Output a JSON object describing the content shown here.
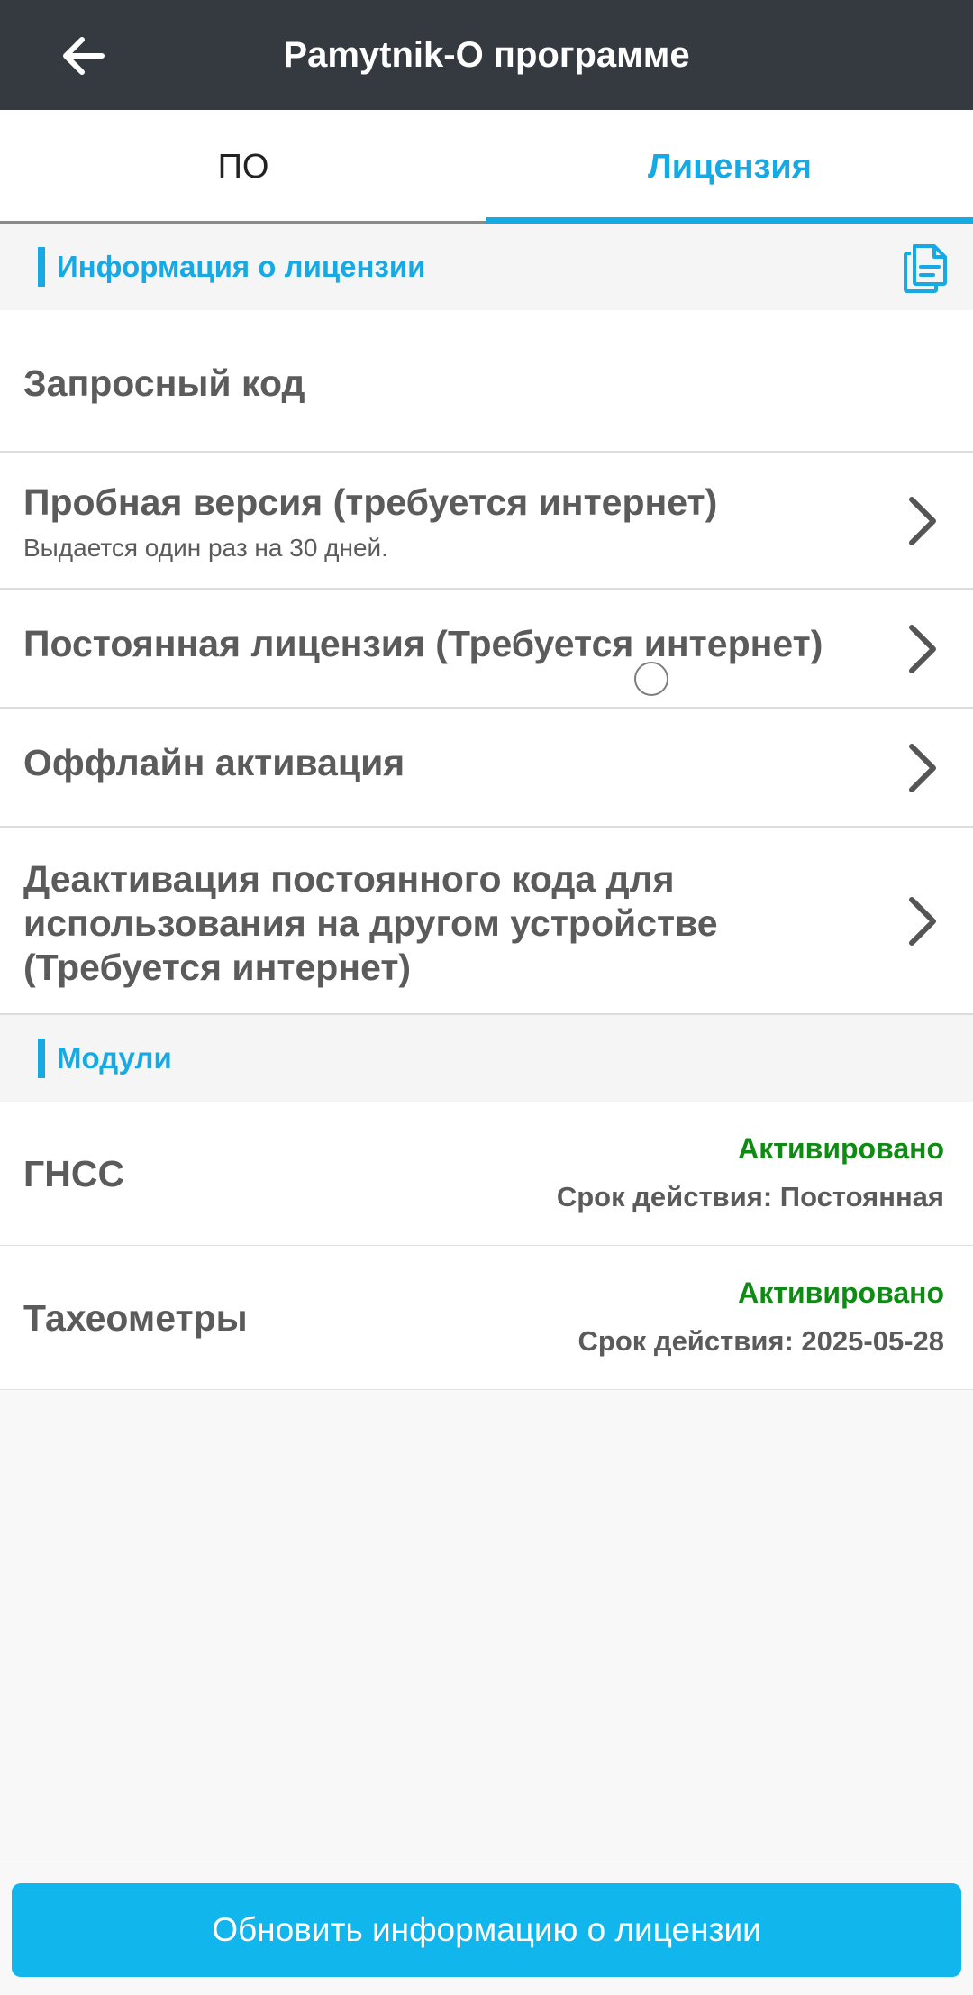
{
  "header": {
    "title": "Pamytnik-О программе",
    "back_icon": "arrow-left-icon"
  },
  "tabs": [
    {
      "label": "ПО",
      "active": false
    },
    {
      "label": "Лицензия",
      "active": true
    }
  ],
  "license_section": {
    "title": "Информация о лицензии",
    "action_icon": "copy-document-icon",
    "items": [
      {
        "label": "Запросный код",
        "subtitle": "",
        "has_chevron": false
      },
      {
        "label": "Пробная версия (требуется интернет)",
        "subtitle": "Выдается один раз на 30 дней.",
        "has_chevron": true
      },
      {
        "label": "Постоянная лицензия (Требуется интернет)",
        "subtitle": "",
        "has_chevron": true
      },
      {
        "label": "Оффлайн активация",
        "subtitle": "",
        "has_chevron": true
      },
      {
        "label_lines": [
          "Деактивация постоянного кода для",
          "использования на другом устройстве",
          "(Требуется интернет)"
        ],
        "has_chevron": true
      }
    ]
  },
  "modules_section": {
    "title": "Модули",
    "modules": [
      {
        "name": "ГНСС",
        "status": "Активировано",
        "term": "Срок действия: Постоянная"
      },
      {
        "name": "Тахеометры",
        "status": "Активировано",
        "term": "Срок действия: 2025-05-28"
      }
    ]
  },
  "footer": {
    "update_button": "Обновить информацию о лицензии"
  },
  "colors": {
    "topbar": "#353a41",
    "accent": "#17a9e4",
    "button": "#11b6ed",
    "status_green": "#0f8a14",
    "text_gray": "#5b5b5b"
  }
}
